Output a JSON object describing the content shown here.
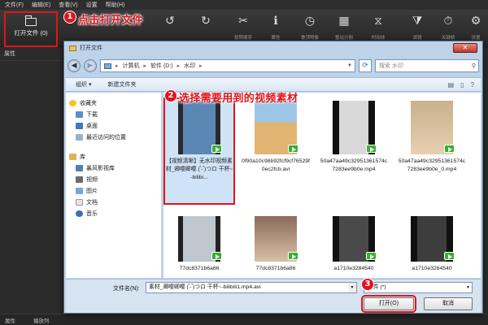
{
  "menu": [
    "文件(F)",
    "编辑(E)",
    "查看(V)",
    "设置",
    "帮助(H)"
  ],
  "toolbar": {
    "open_file_label": "打开文件 (0)",
    "tools": [
      {
        "glyph": "↺",
        "caption": "",
        "icon": "undo-icon"
      },
      {
        "glyph": "↻",
        "caption": "",
        "icon": "redo-icon"
      },
      {
        "glyph": "✂",
        "caption": "按照顺序",
        "icon": "cut-icon"
      },
      {
        "glyph": "ℹ",
        "caption": "属性",
        "icon": "info-icon"
      },
      {
        "glyph": "◷",
        "caption": "叠顶照像",
        "icon": "clock-icon"
      },
      {
        "glyph": "▦",
        "caption": "整站分割",
        "icon": "grid-icon"
      },
      {
        "glyph": "⧖",
        "caption": "时间线",
        "icon": "timeline-icon"
      },
      {
        "glyph": "⧩",
        "caption": "滤镜",
        "icon": "filter-icon"
      },
      {
        "glyph": "⏱",
        "caption": "关键帧",
        "icon": "timer-icon"
      },
      {
        "glyph": "⚙",
        "caption": "设置",
        "icon": "gear-icon"
      }
    ]
  },
  "left_panel": {
    "title": "属性"
  },
  "bottom_bar": [
    "属性",
    "播放列"
  ],
  "annotations": {
    "step1": "点击打开文件",
    "step2": "选择需要用到的视频素材",
    "step3": ""
  },
  "dialog": {
    "title": "打开文件",
    "close": "✕",
    "address": {
      "parts": [
        "计算机",
        "软件 (D:)",
        "水印"
      ]
    },
    "search_placeholder": "搜索 水印",
    "commands": {
      "organize": "组织 ▾",
      "new_folder": "新建文件夹"
    },
    "nav": {
      "favorites": "收藏夹",
      "fav_items": [
        "下载",
        "桌面",
        "最近访问的位置"
      ],
      "library": "库",
      "lib_items": [
        "暴风影视库",
        "视频",
        "图片",
        "文档",
        "音乐"
      ]
    },
    "files": [
      {
        "name": "【视频清晰】无水印视频素材_卿嘤卿嘤 ( ゚- ゚)つロ 干杯~-bilibi...",
        "thumb": "fill-blue"
      },
      {
        "name": "0f90a10c98b92fcf9cf76529f0ec2fcb.avi",
        "thumb": "desert"
      },
      {
        "name": "50a47aa49c32951361574c7283ee9b0e.mp4",
        "thumb": "dark-figure"
      },
      {
        "name": "50a47aa49c32951361574c7283ee9b0e_0.mp4",
        "thumb": "portrait"
      },
      {
        "name": "77dc8371b6a86",
        "thumb": "film"
      },
      {
        "name": "77dc8371b6a86",
        "thumb": "dancer"
      },
      {
        "name": "a1710e3284540",
        "thumb": "film-dark"
      },
      {
        "name": "a1710e3284540",
        "thumb": "film-dark"
      }
    ],
    "filename_label": "文件名(N):",
    "filename_value": "素材_卿嘤卿嘤 ( ゚- ゚)つロ 干杯~-bilibili1.mp4.avi",
    "filetype_value": "文件 (*)",
    "open_button": "打开(O)",
    "cancel_button": "取消"
  }
}
